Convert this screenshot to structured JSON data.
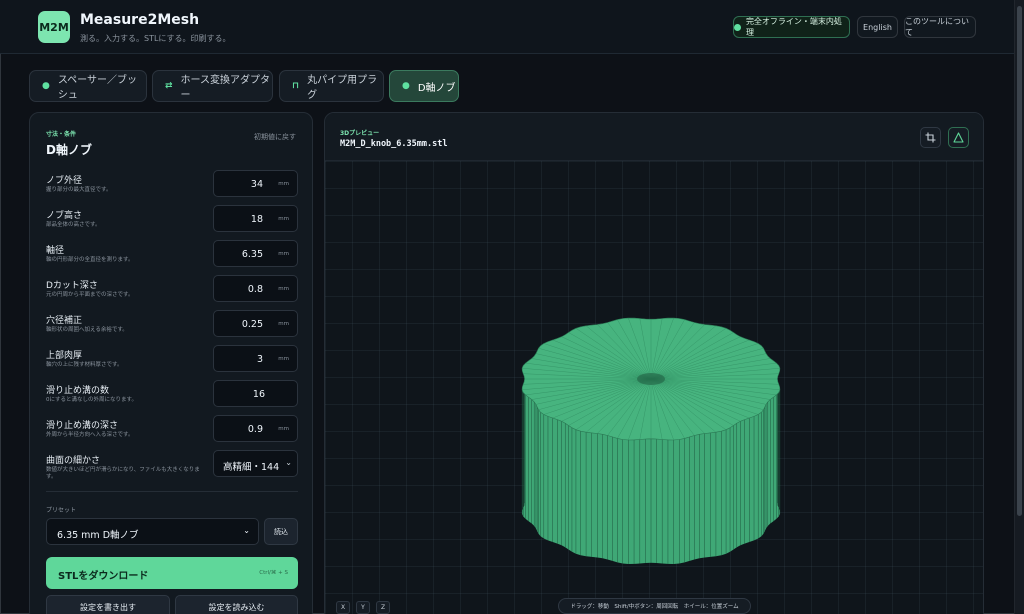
{
  "header": {
    "logo_text": "M2M",
    "title": "Measure2Mesh",
    "tagline": "測る。入力する。STLにする。印刷する。",
    "offline_badge": "完全オフライン・端末内処理",
    "language_button": "English",
    "about_button": "このツールについて"
  },
  "tabs": [
    {
      "icon": "●",
      "label": "スペーサー／ブッシュ",
      "active": false
    },
    {
      "icon": "⇄",
      "label": "ホース変換アダプター",
      "active": false
    },
    {
      "icon": "⊓",
      "label": "丸パイプ用プラグ",
      "active": false
    },
    {
      "icon": "●",
      "label": "D軸ノブ",
      "active": true
    }
  ],
  "form": {
    "section_label": "寸法・条件",
    "title": "D軸ノブ",
    "reset_label": "初期値に戻す",
    "params": [
      {
        "name": "ノブ外径",
        "desc": "握り部分の最大直径です。",
        "value": "34",
        "unit": "mm"
      },
      {
        "name": "ノブ高さ",
        "desc": "部品全体の高さです。",
        "value": "18",
        "unit": "mm"
      },
      {
        "name": "軸径",
        "desc": "軸の円形部分の全直径を測ります。",
        "value": "6.35",
        "unit": "mm"
      },
      {
        "name": "Dカット深さ",
        "desc": "元の円周から平面までの深さです。",
        "value": "0.8",
        "unit": "mm"
      },
      {
        "name": "穴径補正",
        "desc": "軸形状の周囲へ加える余裕です。",
        "value": "0.25",
        "unit": "mm"
      },
      {
        "name": "上部肉厚",
        "desc": "軸穴の上に残す材料厚さです。",
        "value": "3",
        "unit": "mm"
      },
      {
        "name": "滑り止め溝の数",
        "desc": "0にすると溝なしの外周になります。",
        "value": "16",
        "unit": ""
      },
      {
        "name": "滑り止め溝の深さ",
        "desc": "外周から半径方向へ入る深さです。",
        "value": "0.9",
        "unit": "mm"
      }
    ],
    "resolution": {
      "name": "曲面の細かさ",
      "desc": "数値が大きいほど円が滑らかになり、ファイルも大きくなります。",
      "value": "高精細・144"
    },
    "preset_label": "プリセット",
    "preset_value": "6.35 mm D軸ノブ",
    "load_button": "読込",
    "download_button": "STLをダウンロード",
    "download_shortcut": "Ctrl/⌘ + S",
    "export_button": "設定を書き出す",
    "import_button": "設定を読み込む"
  },
  "preview": {
    "section_label": "3Dプレビュー",
    "filename": "M2M_D_knob_6.35mm.stl",
    "axis_buttons": [
      "X",
      "Y",
      "Z"
    ],
    "hint": "ドラッグ：移動　Shift/中ボタン：周回回転　ホイール：位置ズーム",
    "mesh_color": "#3fa876",
    "accent_color": "#5fd79a"
  }
}
